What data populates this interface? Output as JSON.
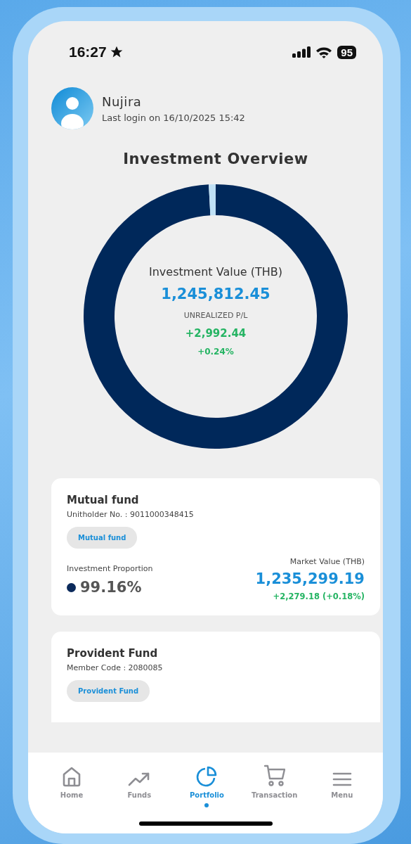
{
  "status_bar": {
    "time": "16:27",
    "battery": "95"
  },
  "profile": {
    "name": "Nujira",
    "last_login": "Last login on 16/10/2025 15:42"
  },
  "overview": {
    "title": "Investment Overview",
    "value_label": "Investment Value (THB)",
    "value": "1,245,812.45",
    "pl_label": "UNREALIZED P/L",
    "pl_amount": "+2,992.44",
    "pl_percent": "+0.24%",
    "chart_data": {
      "type": "donut",
      "values": [
        99.16,
        0.84
      ]
    }
  },
  "funds": [
    {
      "title": "Mutual fund",
      "account": "Unitholder No. : 9011000348415",
      "tag": "Mutual fund",
      "proportion_label": "Investment Proportion",
      "proportion": "99.16%",
      "color": "#0b2a5b",
      "market_label": "Market Value (THB)",
      "market_value": "1,235,299.19",
      "change": "+2,279.18 (+0.18%)"
    },
    {
      "title": "Provident Fund",
      "account": "Member Code : 2080085",
      "tag": "Provident Fund"
    }
  ],
  "nav": [
    {
      "label": "Home",
      "kind": "home",
      "selected": false
    },
    {
      "label": "Funds",
      "kind": "trend",
      "selected": false
    },
    {
      "label": "Portfolio",
      "kind": "pie",
      "selected": true
    },
    {
      "label": "Transaction",
      "kind": "cart",
      "selected": false
    },
    {
      "label": "Menu",
      "kind": "menu",
      "selected": false
    }
  ]
}
